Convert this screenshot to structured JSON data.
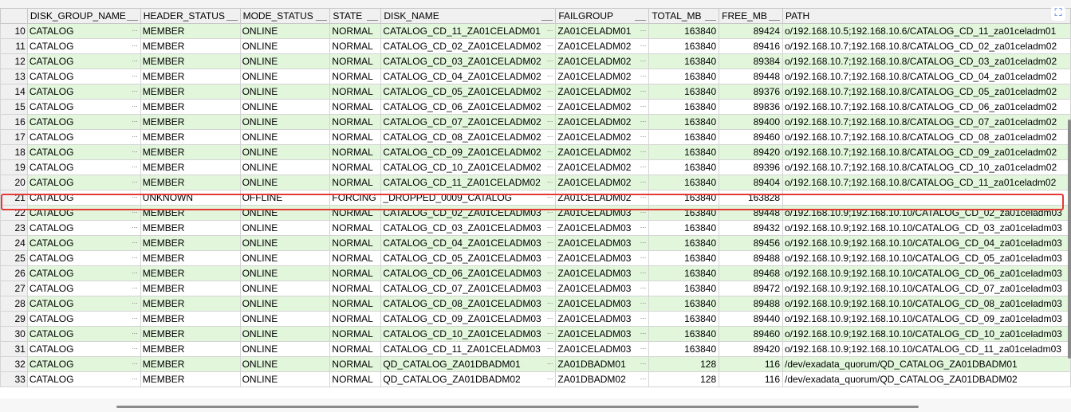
{
  "columns": [
    "DISK_GROUP_NAME",
    "HEADER_STATUS",
    "MODE_STATUS",
    "STATE",
    "DISK_NAME",
    "FAILGROUP",
    "TOTAL_MB",
    "FREE_MB",
    "PATH"
  ],
  "ellipsis": "...",
  "highlighted_row": "21",
  "rows": [
    {
      "n": "10",
      "dg": "CATALOG",
      "hs": "MEMBER",
      "ms": "ONLINE",
      "st": "NORMAL",
      "dn": "CATALOG_CD_11_ZA01CELADM01",
      "fg": "ZA01CELADM01",
      "total": "163840",
      "free": "89424",
      "path": "o/192.168.10.5;192.168.10.6/CATALOG_CD_11_za01celadm01"
    },
    {
      "n": "11",
      "dg": "CATALOG",
      "hs": "MEMBER",
      "ms": "ONLINE",
      "st": "NORMAL",
      "dn": "CATALOG_CD_02_ZA01CELADM02",
      "fg": "ZA01CELADM02",
      "total": "163840",
      "free": "89416",
      "path": "o/192.168.10.7;192.168.10.8/CATALOG_CD_02_za01celadm02"
    },
    {
      "n": "12",
      "dg": "CATALOG",
      "hs": "MEMBER",
      "ms": "ONLINE",
      "st": "NORMAL",
      "dn": "CATALOG_CD_03_ZA01CELADM02",
      "fg": "ZA01CELADM02",
      "total": "163840",
      "free": "89384",
      "path": "o/192.168.10.7;192.168.10.8/CATALOG_CD_03_za01celadm02"
    },
    {
      "n": "13",
      "dg": "CATALOG",
      "hs": "MEMBER",
      "ms": "ONLINE",
      "st": "NORMAL",
      "dn": "CATALOG_CD_04_ZA01CELADM02",
      "fg": "ZA01CELADM02",
      "total": "163840",
      "free": "89448",
      "path": "o/192.168.10.7;192.168.10.8/CATALOG_CD_04_za01celadm02"
    },
    {
      "n": "14",
      "dg": "CATALOG",
      "hs": "MEMBER",
      "ms": "ONLINE",
      "st": "NORMAL",
      "dn": "CATALOG_CD_05_ZA01CELADM02",
      "fg": "ZA01CELADM02",
      "total": "163840",
      "free": "89376",
      "path": "o/192.168.10.7;192.168.10.8/CATALOG_CD_05_za01celadm02"
    },
    {
      "n": "15",
      "dg": "CATALOG",
      "hs": "MEMBER",
      "ms": "ONLINE",
      "st": "NORMAL",
      "dn": "CATALOG_CD_06_ZA01CELADM02",
      "fg": "ZA01CELADM02",
      "total": "163840",
      "free": "89836",
      "path": "o/192.168.10.7;192.168.10.8/CATALOG_CD_06_za01celadm02"
    },
    {
      "n": "16",
      "dg": "CATALOG",
      "hs": "MEMBER",
      "ms": "ONLINE",
      "st": "NORMAL",
      "dn": "CATALOG_CD_07_ZA01CELADM02",
      "fg": "ZA01CELADM02",
      "total": "163840",
      "free": "89400",
      "path": "o/192.168.10.7;192.168.10.8/CATALOG_CD_07_za01celadm02"
    },
    {
      "n": "17",
      "dg": "CATALOG",
      "hs": "MEMBER",
      "ms": "ONLINE",
      "st": "NORMAL",
      "dn": "CATALOG_CD_08_ZA01CELADM02",
      "fg": "ZA01CELADM02",
      "total": "163840",
      "free": "89460",
      "path": "o/192.168.10.7;192.168.10.8/CATALOG_CD_08_za01celadm02"
    },
    {
      "n": "18",
      "dg": "CATALOG",
      "hs": "MEMBER",
      "ms": "ONLINE",
      "st": "NORMAL",
      "dn": "CATALOG_CD_09_ZA01CELADM02",
      "fg": "ZA01CELADM02",
      "total": "163840",
      "free": "89420",
      "path": "o/192.168.10.7;192.168.10.8/CATALOG_CD_09_za01celadm02"
    },
    {
      "n": "19",
      "dg": "CATALOG",
      "hs": "MEMBER",
      "ms": "ONLINE",
      "st": "NORMAL",
      "dn": "CATALOG_CD_10_ZA01CELADM02",
      "fg": "ZA01CELADM02",
      "total": "163840",
      "free": "89396",
      "path": "o/192.168.10.7;192.168.10.8/CATALOG_CD_10_za01celadm02"
    },
    {
      "n": "20",
      "dg": "CATALOG",
      "hs": "MEMBER",
      "ms": "ONLINE",
      "st": "NORMAL",
      "dn": "CATALOG_CD_11_ZA01CELADM02",
      "fg": "ZA01CELADM02",
      "total": "163840",
      "free": "89404",
      "path": "o/192.168.10.7;192.168.10.8/CATALOG_CD_11_za01celadm02"
    },
    {
      "n": "21",
      "dg": "CATALOG",
      "hs": "UNKNOWN",
      "ms": "OFFLINE",
      "st": "FORCING",
      "dn": "_DROPPED_0009_CATALOG",
      "fg": "ZA01CELADM02",
      "total": "163840",
      "free": "163828",
      "path": ""
    },
    {
      "n": "22",
      "dg": "CATALOG",
      "hs": "MEMBER",
      "ms": "ONLINE",
      "st": "NORMAL",
      "dn": "CATALOG_CD_02_ZA01CELADM03",
      "fg": "ZA01CELADM03",
      "total": "163840",
      "free": "89448",
      "path": "o/192.168.10.9;192.168.10.10/CATALOG_CD_02_za01celadm03"
    },
    {
      "n": "23",
      "dg": "CATALOG",
      "hs": "MEMBER",
      "ms": "ONLINE",
      "st": "NORMAL",
      "dn": "CATALOG_CD_03_ZA01CELADM03",
      "fg": "ZA01CELADM03",
      "total": "163840",
      "free": "89432",
      "path": "o/192.168.10.9;192.168.10.10/CATALOG_CD_03_za01celadm03"
    },
    {
      "n": "24",
      "dg": "CATALOG",
      "hs": "MEMBER",
      "ms": "ONLINE",
      "st": "NORMAL",
      "dn": "CATALOG_CD_04_ZA01CELADM03",
      "fg": "ZA01CELADM03",
      "total": "163840",
      "free": "89456",
      "path": "o/192.168.10.9;192.168.10.10/CATALOG_CD_04_za01celadm03"
    },
    {
      "n": "25",
      "dg": "CATALOG",
      "hs": "MEMBER",
      "ms": "ONLINE",
      "st": "NORMAL",
      "dn": "CATALOG_CD_05_ZA01CELADM03",
      "fg": "ZA01CELADM03",
      "total": "163840",
      "free": "89488",
      "path": "o/192.168.10.9;192.168.10.10/CATALOG_CD_05_za01celadm03"
    },
    {
      "n": "26",
      "dg": "CATALOG",
      "hs": "MEMBER",
      "ms": "ONLINE",
      "st": "NORMAL",
      "dn": "CATALOG_CD_06_ZA01CELADM03",
      "fg": "ZA01CELADM03",
      "total": "163840",
      "free": "89468",
      "path": "o/192.168.10.9;192.168.10.10/CATALOG_CD_06_za01celadm03"
    },
    {
      "n": "27",
      "dg": "CATALOG",
      "hs": "MEMBER",
      "ms": "ONLINE",
      "st": "NORMAL",
      "dn": "CATALOG_CD_07_ZA01CELADM03",
      "fg": "ZA01CELADM03",
      "total": "163840",
      "free": "89472",
      "path": "o/192.168.10.9;192.168.10.10/CATALOG_CD_07_za01celadm03"
    },
    {
      "n": "28",
      "dg": "CATALOG",
      "hs": "MEMBER",
      "ms": "ONLINE",
      "st": "NORMAL",
      "dn": "CATALOG_CD_08_ZA01CELADM03",
      "fg": "ZA01CELADM03",
      "total": "163840",
      "free": "89488",
      "path": "o/192.168.10.9;192.168.10.10/CATALOG_CD_08_za01celadm03"
    },
    {
      "n": "29",
      "dg": "CATALOG",
      "hs": "MEMBER",
      "ms": "ONLINE",
      "st": "NORMAL",
      "dn": "CATALOG_CD_09_ZA01CELADM03",
      "fg": "ZA01CELADM03",
      "total": "163840",
      "free": "89440",
      "path": "o/192.168.10.9;192.168.10.10/CATALOG_CD_09_za01celadm03"
    },
    {
      "n": "30",
      "dg": "CATALOG",
      "hs": "MEMBER",
      "ms": "ONLINE",
      "st": "NORMAL",
      "dn": "CATALOG_CD_10_ZA01CELADM03",
      "fg": "ZA01CELADM03",
      "total": "163840",
      "free": "89460",
      "path": "o/192.168.10.9;192.168.10.10/CATALOG_CD_10_za01celadm03"
    },
    {
      "n": "31",
      "dg": "CATALOG",
      "hs": "MEMBER",
      "ms": "ONLINE",
      "st": "NORMAL",
      "dn": "CATALOG_CD_11_ZA01CELADM03",
      "fg": "ZA01CELADM03",
      "total": "163840",
      "free": "89420",
      "path": "o/192.168.10.9;192.168.10.10/CATALOG_CD_11_za01celadm03"
    },
    {
      "n": "32",
      "dg": "CATALOG",
      "hs": "MEMBER",
      "ms": "ONLINE",
      "st": "NORMAL",
      "dn": "QD_CATALOG_ZA01DBADM01",
      "fg": "ZA01DBADM01",
      "total": "128",
      "free": "116",
      "path": "/dev/exadata_quorum/QD_CATALOG_ZA01DBADM01"
    },
    {
      "n": "33",
      "dg": "CATALOG",
      "hs": "MEMBER",
      "ms": "ONLINE",
      "st": "NORMAL",
      "dn": "QD_CATALOG_ZA01DBADM02",
      "fg": "ZA01DBADM02",
      "total": "128",
      "free": "116",
      "path": "/dev/exadata_quorum/QD_CATALOG_ZA01DBADM02"
    }
  ]
}
